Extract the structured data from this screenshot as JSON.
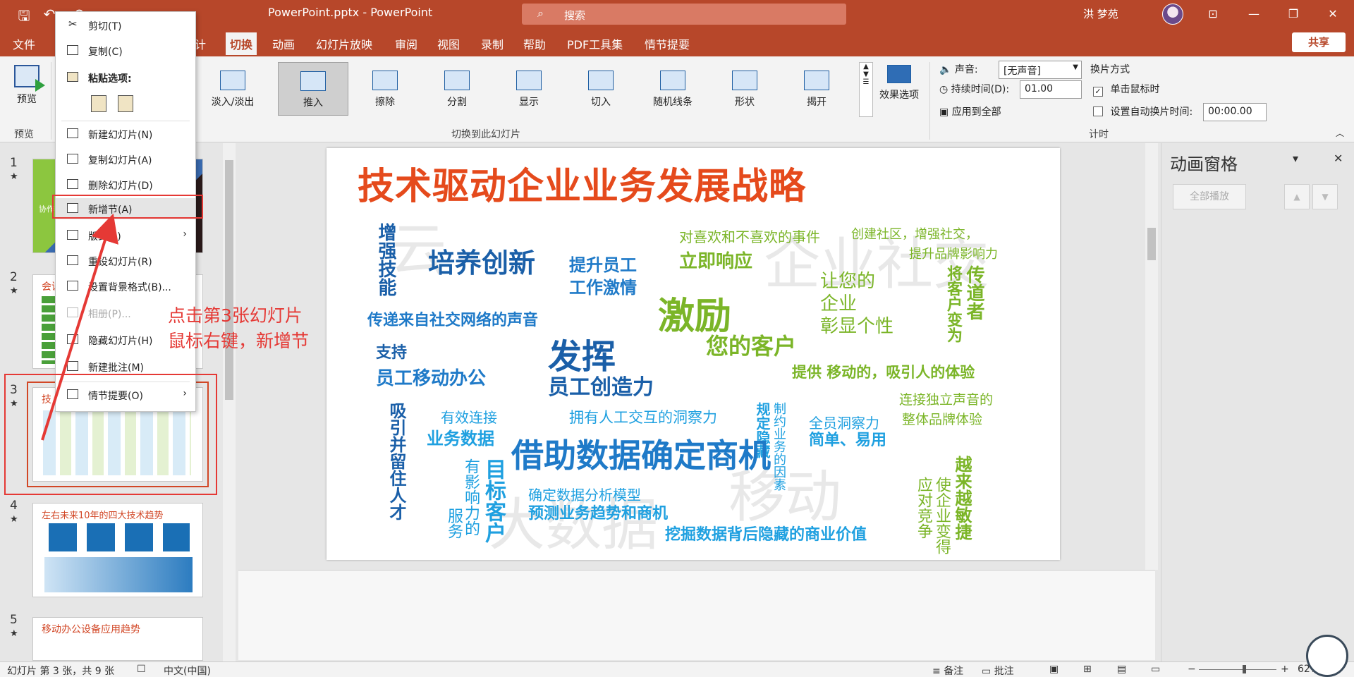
{
  "titlebar": {
    "doc_title": "PowerPoint.pptx  -  PowerPoint",
    "search_placeholder": "搜索",
    "user_name": "洪 梦苑",
    "qa_save": "🖫",
    "qa_undo": "↶",
    "qa_redo": "↷",
    "win_ribbon": "⊡",
    "win_min": "—",
    "win_max": "❐",
    "win_close": "✕"
  },
  "tabs": {
    "file": "文件",
    "design_partial": "计",
    "transitions": "切换",
    "animations": "动画",
    "slideshow": "幻灯片放映",
    "review": "审阅",
    "view": "视图",
    "record": "录制",
    "help": "帮助",
    "pdf": "PDF工具集",
    "storyboard": "情节提要",
    "share": "共享"
  },
  "ribbon": {
    "preview_label": "预览",
    "preview_group": "预览",
    "transition_group": "切换到此幻灯片",
    "timing_group": "计时",
    "transitions": [
      {
        "label": "淡入/淡出"
      },
      {
        "label": "推入"
      },
      {
        "label": "擦除"
      },
      {
        "label": "分割"
      },
      {
        "label": "显示"
      },
      {
        "label": "切入"
      },
      {
        "label": "随机线条"
      },
      {
        "label": "形状"
      },
      {
        "label": "揭开"
      }
    ],
    "effect_options": "效果选项",
    "sound_label": "声音:",
    "sound_value": "[无声音]",
    "duration_label": "持续时间(D):",
    "duration_value": "01.00",
    "apply_all": "应用到全部",
    "advance_label": "换片方式",
    "on_click": "单击鼠标时",
    "after_label": "设置自动换片时间:",
    "after_value": "00:00.00",
    "check_mark": "✓"
  },
  "thumbnails": [
    {
      "num": "1",
      "star": "★",
      "caption": "协作"
    },
    {
      "num": "2",
      "star": "★",
      "caption": "会议"
    },
    {
      "num": "3",
      "star": "★",
      "caption": "技"
    },
    {
      "num": "4",
      "star": "★",
      "caption": "左右未来10年的四大技术趋势"
    },
    {
      "num": "5",
      "star": "★",
      "caption": "移动办公设备应用趋势"
    }
  ],
  "slide": {
    "title": "技术驱动企业业务发展战略",
    "watermarks": [
      "云",
      "企业社交",
      "移动",
      "大数据"
    ],
    "words": [
      "增强技能",
      "培养创新",
      "提升员工",
      "工作激情",
      "对喜欢和不喜欢的事件",
      "立即响应",
      "创建社区，增强社交，",
      "提升品牌影响力",
      "传递来自社交网络的声音",
      "激励",
      "让您的",
      "企业",
      "彰显个性",
      "将客户变为",
      "传道者",
      "支持",
      "发挥",
      "您的客户",
      "员工移动办公",
      "员工创造力",
      "提供 移动的，吸引人的体验",
      "连接独立声音的",
      "整体品牌体验",
      "有效连接",
      "业务数据",
      "拥有人工交互的洞察力",
      "规定隐藏",
      "制约业务的因素",
      "全员洞察力",
      "简单、易用",
      "吸引并留住人才",
      "借助数据确定商机",
      "服务",
      "有影响力的",
      "目标客户",
      "确定数据分析模型",
      "预测业务趋势和商机",
      "挖掘数据背后隐藏的商业价值",
      "应对竞争",
      "使企业变得",
      "越来越敏捷"
    ]
  },
  "context_menu": {
    "cut": "剪切(T)",
    "copy": "复制(C)",
    "paste_options": "粘贴选项:",
    "new_slide": "新建幻灯片(N)",
    "duplicate_slide": "复制幻灯片(A)",
    "delete_slide": "删除幻灯片(D)",
    "add_section": "新增节(A)",
    "layout": "版式(L)",
    "reset_slide": "重设幻灯片(R)",
    "format_background": "设置背景格式(B)...",
    "photo_album": "相册(P)...",
    "hide_slide": "隐藏幻灯片(H)",
    "new_comment": "新建批注(M)",
    "storyboard": "情节提要(O)",
    "submenu_arrow": "›"
  },
  "annotation": {
    "line1": "点击第3张幻灯片",
    "line2": "鼠标右键，新增节"
  },
  "anim_pane": {
    "title": "动画窗格",
    "dropdown": "▾",
    "close": "✕",
    "play_all": "全部播放",
    "up": "▲",
    "down": "▼"
  },
  "statusbar": {
    "slide_info": "幻灯片 第 3 张，共 9 张",
    "language": "中文(中国)",
    "notes": "备注",
    "comments": "批注",
    "zoom": "62%"
  },
  "colors": {
    "accent": "#b7472a",
    "annotation": "#e53935",
    "slide_title": "#e54a1c",
    "word_blue": "#1f7ac8",
    "word_green": "#7bb528"
  }
}
